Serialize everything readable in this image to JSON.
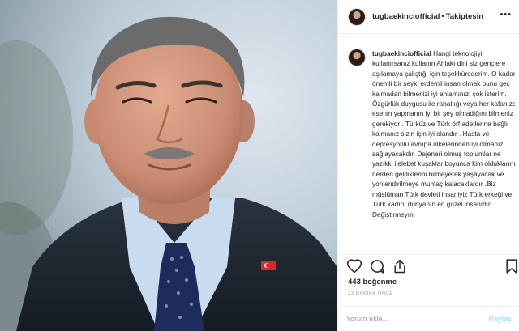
{
  "photo": {
    "alt": ""
  },
  "header": {
    "username": "tugbaekinciofficial",
    "separator": "•",
    "follow_label": "Takiptesin",
    "more_icon": "ellipsis-icon"
  },
  "caption": {
    "username": "tugbaekinciofficial",
    "text": "Hangi teknolojiyi kullanırsanız kullanın Ahlakı dini siz gençlere aşılamaya çalıştığı için teşekkürederim. O kadar önemli bir şeyki erdemli insan olmak bunu geç kalmadan bilmenizi iyi anlamınızı çok isterim. Özgürlük duygusu ile rahatlığı veya her kafanıza esenin yapmanın iyi bir şey olmadığını bilmeniz gerekiyor . Türküz ve Türk örf adetlerine bağlı kalmanız sizin için iyi olandır . Hasta ve depresyonlu avrupa ülkelerinden iyi olmanızı sağlayacakdır. Dejeneri olmuş toplumlar ne yazıkki ilelebet kuşaklar boyunca kim olduklarını nerden geldiklerini bilmeyerek yaşayacak ve yonlendirilmeye muhtaç kalacaklardır .Biz müslüman Türk devleti insaniyiz Türk erkeği ve Türk kadını dünyanın en güzel insanıdır. Değiştirmeyın"
  },
  "actions": {
    "like_icon": "heart-icon",
    "comment_icon": "comment-icon",
    "share_icon": "share-icon",
    "save_icon": "bookmark-icon"
  },
  "likes": "443 beğenme",
  "timestamp": "23 DAKİKA ÖNCE",
  "add_comment": {
    "placeholder": "Yorum ekle...",
    "post_label": "Paylaş"
  }
}
